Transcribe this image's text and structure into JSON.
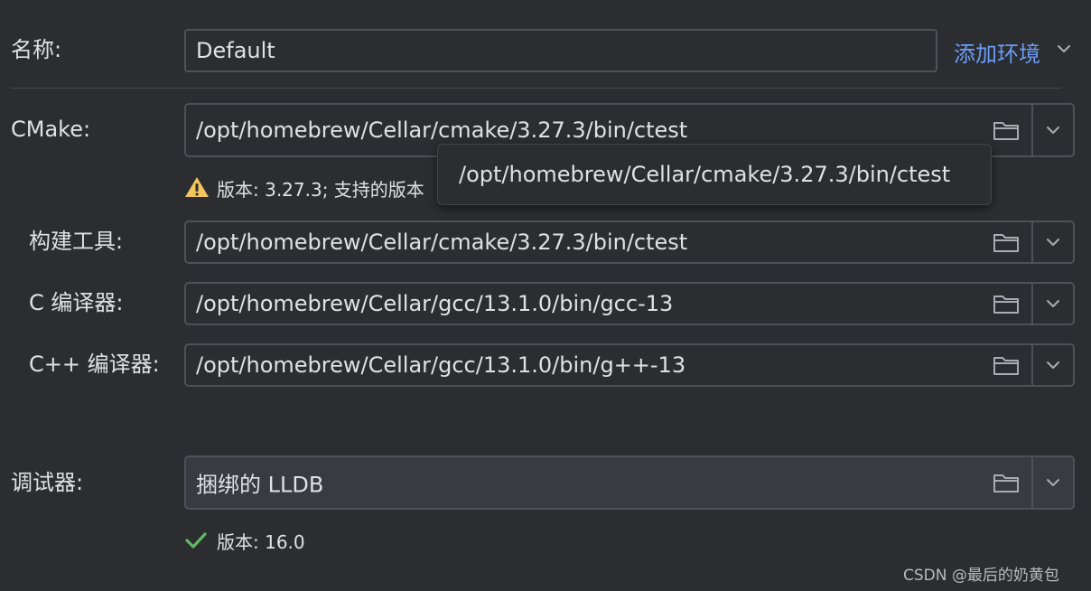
{
  "name_row": {
    "label": "名称:",
    "value": "Default",
    "add_env_label": "添加环境"
  },
  "cmake_row": {
    "label": "CMake:",
    "value": "/opt/homebrew/Cellar/cmake/3.27.3/bin/ctest",
    "warning_text": "版本: 3.27.3; 支持的版本",
    "tooltip_text": "/opt/homebrew/Cellar/cmake/3.27.3/bin/ctest"
  },
  "build_tool_row": {
    "label": "构建工具:",
    "value": "/opt/homebrew/Cellar/cmake/3.27.3/bin/ctest"
  },
  "c_compiler_row": {
    "label": "C 编译器:",
    "value": "/opt/homebrew/Cellar/gcc/13.1.0/bin/gcc-13"
  },
  "cpp_compiler_row": {
    "label": "C++ 编译器:",
    "value": "/opt/homebrew/Cellar/gcc/13.1.0/bin/g++-13"
  },
  "debugger_row": {
    "label": "调试器:",
    "value": "捆绑的 LLDB",
    "version_text": "版本: 16.0"
  },
  "watermark": "CSDN @最后的奶黄包",
  "colors": {
    "background": "#2b2d30",
    "border": "#4e5157",
    "link": "#6a9cf7",
    "warning": "#f2c55c",
    "success": "#5fb865"
  },
  "icons": {
    "folder": "folder-icon",
    "chevron": "chevron-down-icon",
    "warning": "warning-icon",
    "success": "checkmark-icon"
  }
}
